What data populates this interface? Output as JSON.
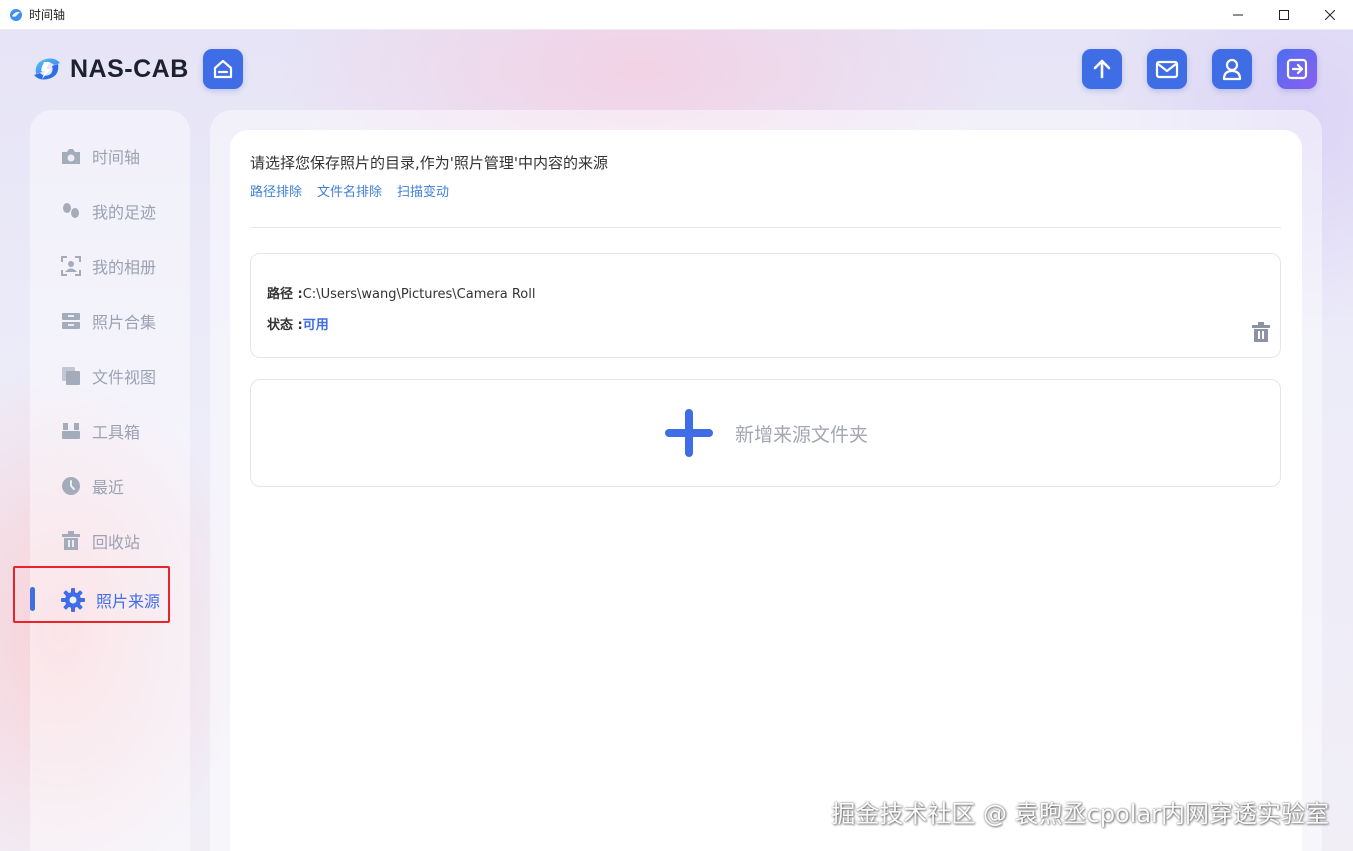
{
  "window": {
    "title": "时间轴",
    "controls": [
      "minimize-icon",
      "maximize-icon",
      "close-icon"
    ]
  },
  "header": {
    "logo_text": "NAS-CAB",
    "home_icon": "home-icon",
    "actions": [
      {
        "name": "upload",
        "icon": "arrow-up-icon"
      },
      {
        "name": "messages",
        "icon": "mail-icon"
      },
      {
        "name": "user",
        "icon": "user-icon"
      },
      {
        "name": "logout",
        "icon": "logout-icon"
      }
    ],
    "accent_color": "#3f6de6"
  },
  "sidebar": {
    "items": [
      {
        "label": "时间轴",
        "icon": "camera-icon",
        "active": false
      },
      {
        "label": "我的足迹",
        "icon": "footprint-icon",
        "active": false
      },
      {
        "label": "我的相册",
        "icon": "album-icon",
        "active": false
      },
      {
        "label": "照片合集",
        "icon": "collection-icon",
        "active": false
      },
      {
        "label": "文件视图",
        "icon": "files-icon",
        "active": false
      },
      {
        "label": "工具箱",
        "icon": "toolbox-icon",
        "active": false
      },
      {
        "label": "最近",
        "icon": "clock-icon",
        "active": false
      },
      {
        "label": "回收站",
        "icon": "trash-icon",
        "active": false
      },
      {
        "label": "照片来源",
        "icon": "gear-icon",
        "active": true
      }
    ]
  },
  "main": {
    "description": "请选择您保存照片的目录,作为'照片管理'中内容的来源",
    "links": [
      "路径排除",
      "文件名排除",
      "扫描变动"
    ],
    "source": {
      "path_label": "路径 :",
      "path_value": "C:\\Users\\wang\\Pictures\\Camera Roll",
      "status_label": "状态 :",
      "status_value": "可用"
    },
    "add_label": "新增来源文件夹"
  },
  "watermark": "掘金技术社区 @ 袁煦丞cpolar内网穿透实验室"
}
